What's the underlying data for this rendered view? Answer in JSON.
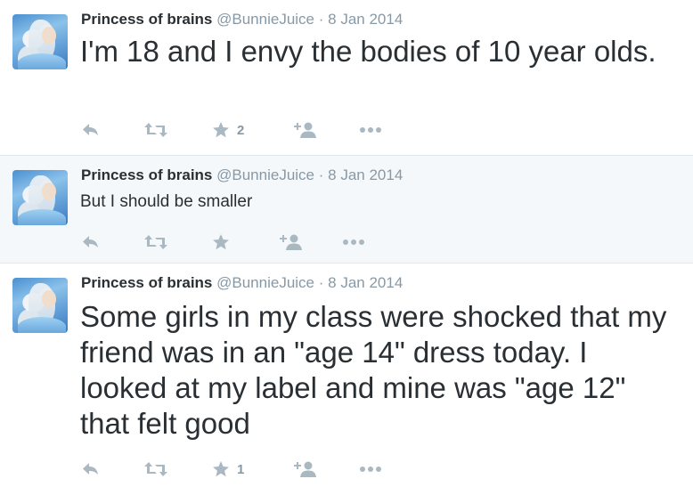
{
  "tweets": [
    {
      "name": "Princess of brains",
      "handle": "@BunnieJuice",
      "separator": "·",
      "date": "8 Jan 2014",
      "text": "I'm 18 and I envy the bodies of 10 year olds.",
      "favorites": "2"
    },
    {
      "name": "Princess of brains",
      "handle": "@BunnieJuice",
      "separator": "·",
      "date": "8 Jan 2014",
      "text": "But I should be smaller",
      "favorites": ""
    },
    {
      "name": "Princess of brains",
      "handle": "@BunnieJuice",
      "separator": "·",
      "date": "8 Jan 2014",
      "text": "Some girls in my class were shocked that my friend was in an \"age 14\" dress today. I looked at my label and mine was \"age 12\" that felt good",
      "favorites": "1"
    }
  ],
  "icons": {
    "reply": "reply-icon",
    "retweet": "retweet-icon",
    "favorite": "star-icon",
    "follow": "follow-icon",
    "more": "more-icon"
  },
  "colors": {
    "text": "#292f33",
    "muted": "#8899a6",
    "icon": "#aab8c2",
    "highlight_bg": "#f5f8fa",
    "divider": "#e1e8ed"
  }
}
